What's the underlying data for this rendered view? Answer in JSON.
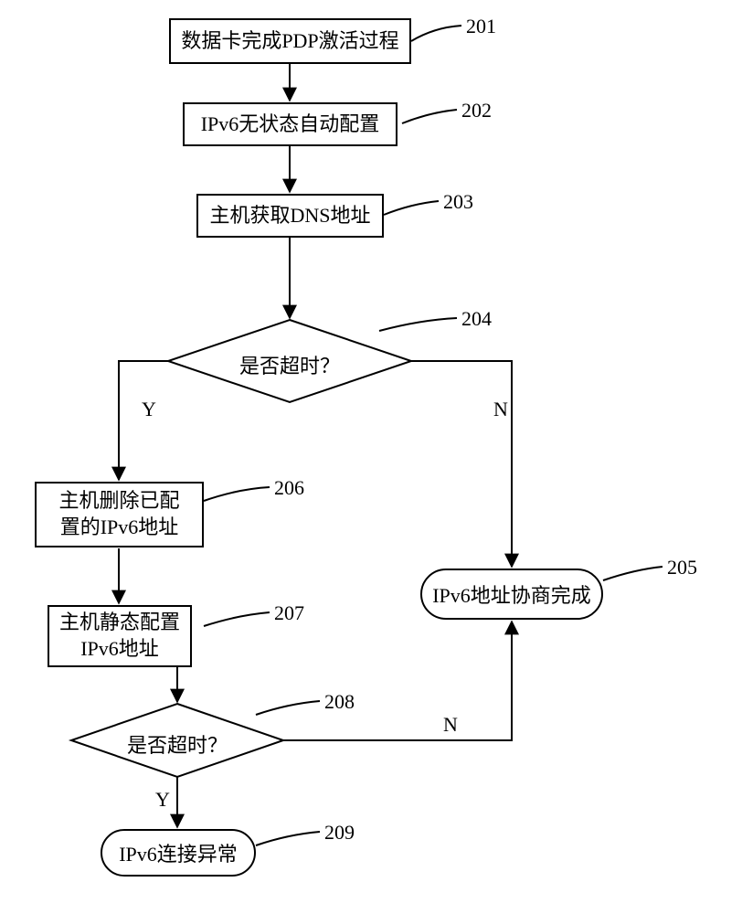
{
  "steps": {
    "s201": "数据卡完成PDP激活过程",
    "s202": "IPv6无状态自动配置",
    "s203": "主机获取DNS地址",
    "s204": "是否超时？",
    "s205": "IPv6地址协商完成",
    "s206": "主机删除已配\n置的IPv6地址",
    "s207": "主机静态配置\nIPv6地址",
    "s208": "是否超时？",
    "s209": "IPv6连接异常"
  },
  "refs": {
    "r201": "201",
    "r202": "202",
    "r203": "203",
    "r204": "204",
    "r205": "205",
    "r206": "206",
    "r207": "207",
    "r208": "208",
    "r209": "209"
  },
  "labels": {
    "yes1": "Y",
    "no1": "N",
    "yes2": "Y",
    "no2": "N"
  }
}
